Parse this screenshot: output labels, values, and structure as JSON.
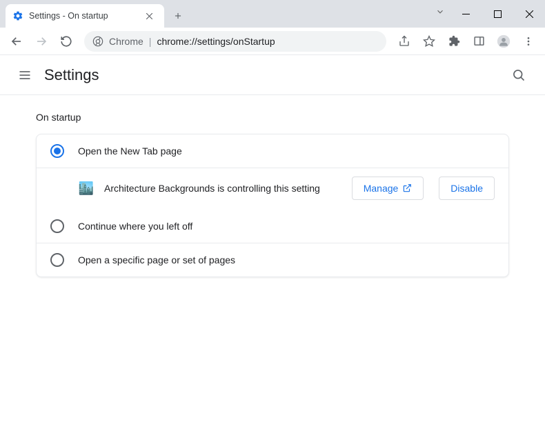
{
  "window": {
    "tab_title": "Settings - On startup"
  },
  "omnibox": {
    "origin": "Chrome",
    "url": "chrome://settings/onStartup"
  },
  "header": {
    "title": "Settings"
  },
  "section": {
    "title": "On startup",
    "options": [
      {
        "label": "Open the New Tab page",
        "selected": true
      },
      {
        "label": "Continue where you left off",
        "selected": false
      },
      {
        "label": "Open a specific page or set of pages",
        "selected": false
      }
    ],
    "extension": {
      "name": "Architecture Backgrounds",
      "message": "Architecture Backgrounds is controlling this setting",
      "manage_label": "Manage",
      "disable_label": "Disable"
    }
  }
}
